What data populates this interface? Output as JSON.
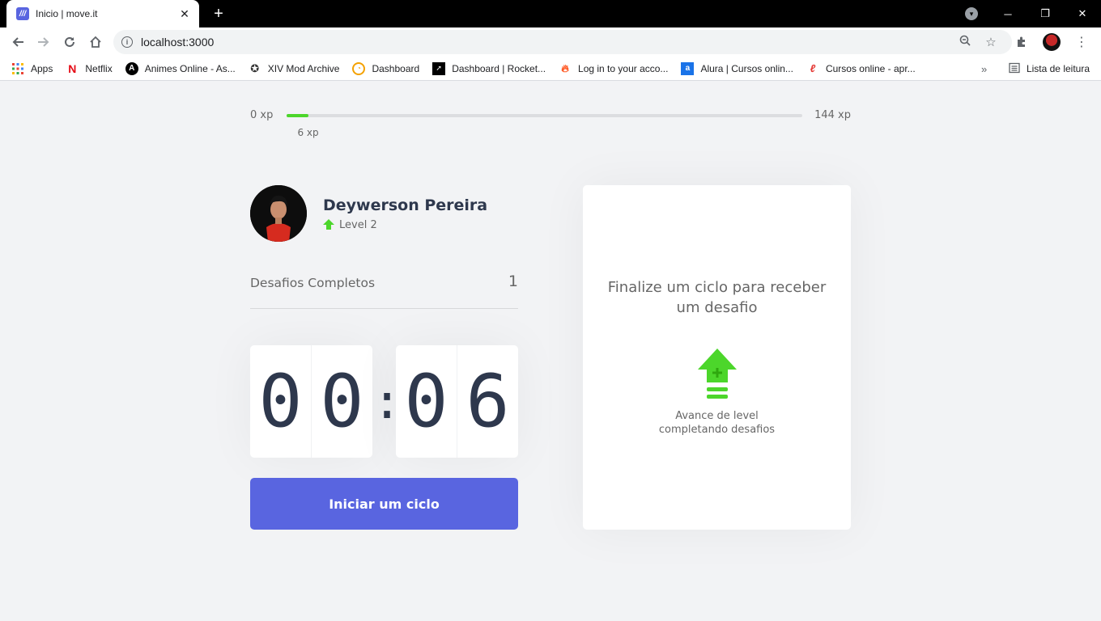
{
  "browser": {
    "tab_title": "Inicio | move.it",
    "tab_close": "✕",
    "new_tab": "+",
    "url": "localhost:3000",
    "window_controls": [
      "─",
      "❐",
      "✕"
    ]
  },
  "bookmarks": {
    "items": [
      {
        "label": "Apps",
        "icon": "apps-grid-icon",
        "color": "#ea4335"
      },
      {
        "label": "Netflix",
        "icon": "netflix-icon",
        "color": "#e50914"
      },
      {
        "label": "Animes Online - As...",
        "icon": "anime-icon",
        "color": "#000000"
      },
      {
        "label": "XIV Mod Archive",
        "icon": "xiv-icon",
        "color": "#333333"
      },
      {
        "label": "Dashboard",
        "icon": "dashboard-icon",
        "color": "#f4a100"
      },
      {
        "label": "Dashboard | Rocket...",
        "icon": "rocket-icon",
        "color": "#000000"
      },
      {
        "label": "Log in to your acco...",
        "icon": "flame-icon",
        "color": "#ff5722"
      },
      {
        "label": "Alura | Cursos onlin...",
        "icon": "alura-icon",
        "color": "#1a73e8"
      },
      {
        "label": "Cursos online - apr...",
        "icon": "cursos-icon",
        "color": "#e53935"
      }
    ],
    "more": "»",
    "reading_list": "Lista de leitura"
  },
  "xp": {
    "min_label": "0 xp",
    "max_label": "144 xp",
    "current_label": "6 xp",
    "current": 6,
    "max": 144
  },
  "profile": {
    "name": "Deywerson Pereira",
    "level_label": "Level 2"
  },
  "completed": {
    "label": "Desafios Completos",
    "count": "1"
  },
  "countdown": {
    "minutes": [
      "0",
      "0"
    ],
    "separator": ":",
    "seconds": [
      "0",
      "6"
    ]
  },
  "cycle_button": "Iniciar um ciclo",
  "challenge": {
    "title": "Finalize um ciclo para receber um desafio",
    "hint": "Avance de level completando desafios"
  },
  "colors": {
    "accent": "#5965e0",
    "green": "#4cd62b",
    "text": "#2e384d",
    "background": "#f2f3f5"
  }
}
